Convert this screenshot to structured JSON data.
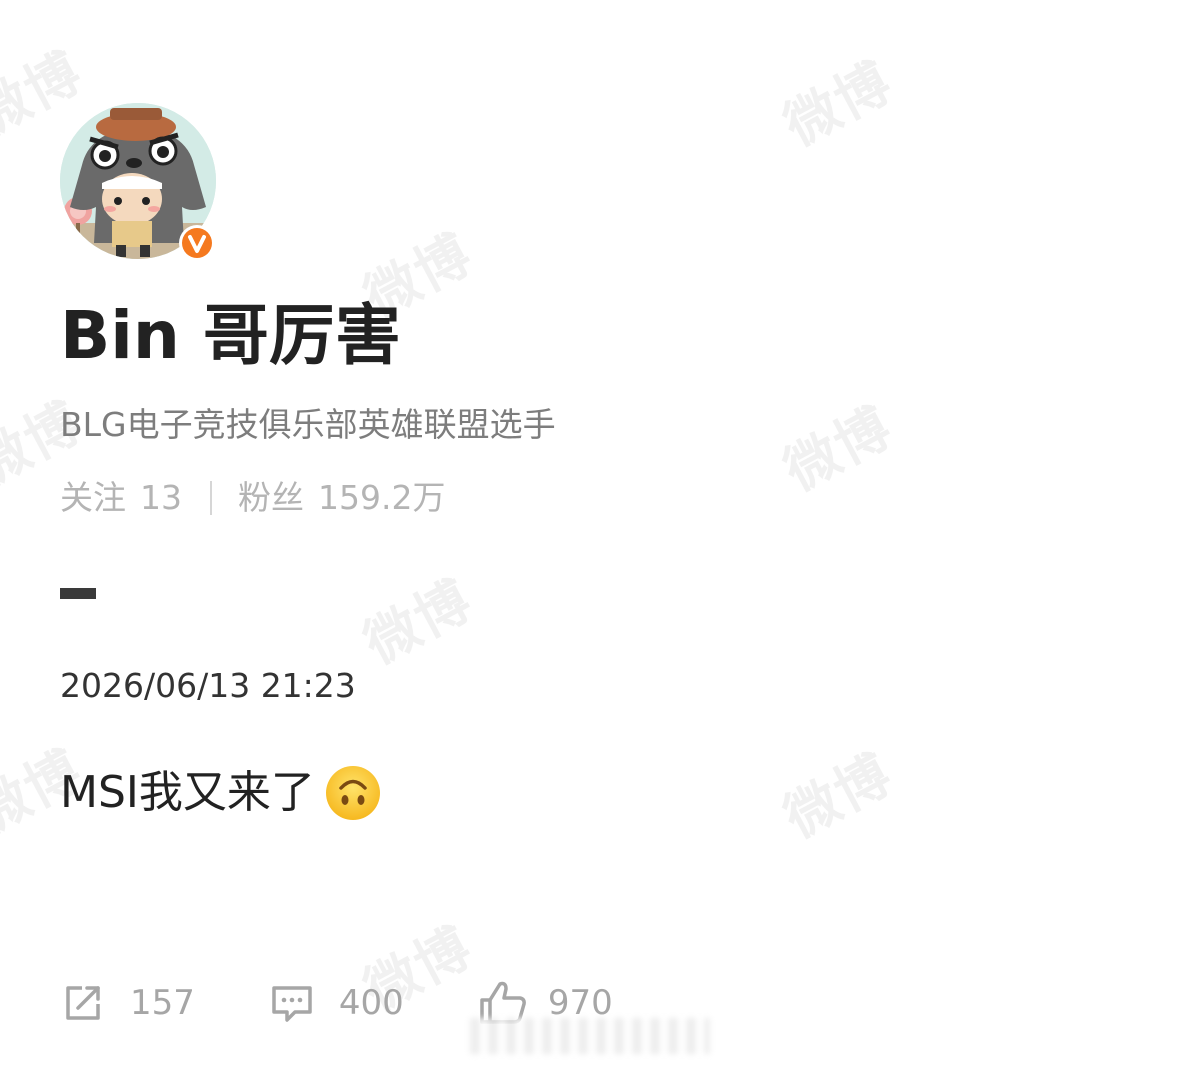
{
  "watermark": "微博",
  "profile": {
    "username": "Bin 哥厉害",
    "bio": "BLG电子竞技俱乐部英雄联盟选手",
    "following_label": "关注",
    "following_count": "13",
    "followers_label": "粉丝",
    "followers_count": "159.2万",
    "verified_color": "#f5791f"
  },
  "post": {
    "timestamp": "2026/06/13 21:23",
    "text": "MSI我又来了",
    "emoji": "upside-down-face-emoji"
  },
  "actions": {
    "repost_count": "157",
    "comment_count": "400",
    "like_count": "970"
  },
  "icons": {
    "repost": "share-icon",
    "comment": "comment-icon",
    "like": "thumbs-up-icon",
    "verified": "verified-badge-icon"
  }
}
